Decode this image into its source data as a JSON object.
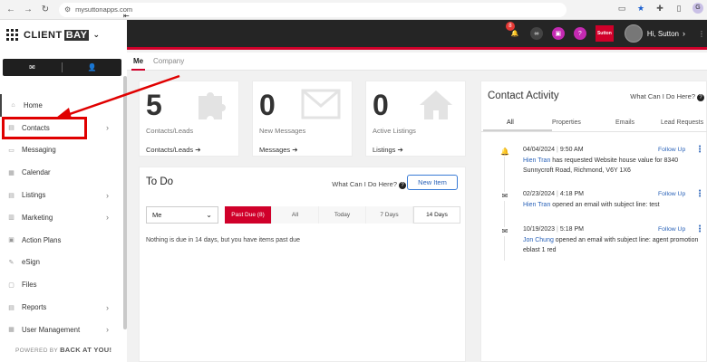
{
  "browser": {
    "url": "mysuttonapps.com",
    "profile_initial": "G"
  },
  "sidebar": {
    "brand_main": "CLIENT",
    "brand_accent": "BAY",
    "items": [
      {
        "label": "Home",
        "icon": "home-icon",
        "has_arrow": false
      },
      {
        "label": "Contacts",
        "icon": "contacts-icon",
        "has_arrow": true
      },
      {
        "label": "Messaging",
        "icon": "chat-icon",
        "has_arrow": false
      },
      {
        "label": "Calendar",
        "icon": "calendar-icon",
        "has_arrow": false
      },
      {
        "label": "Listings",
        "icon": "listings-icon",
        "has_arrow": true
      },
      {
        "label": "Marketing",
        "icon": "marketing-icon",
        "has_arrow": true
      },
      {
        "label": "Action Plans",
        "icon": "action-plans-icon",
        "has_arrow": false
      },
      {
        "label": "eSign",
        "icon": "esign-icon",
        "has_arrow": false
      },
      {
        "label": "Files",
        "icon": "files-icon",
        "has_arrow": false
      },
      {
        "label": "Reports",
        "icon": "reports-icon",
        "has_arrow": true
      },
      {
        "label": "User Management",
        "icon": "user-management-icon",
        "has_arrow": true
      }
    ],
    "powered_prefix": "POWERED BY",
    "powered_brand": "BACK AT YOU!"
  },
  "topbar": {
    "notification_count": "8",
    "greeting": "Hi, Sutton",
    "logo_text": "Sutton"
  },
  "tabs": {
    "me": "Me",
    "company": "Company"
  },
  "stats": [
    {
      "value": "5",
      "label": "Contacts/Leads",
      "link": "Contacts/Leads",
      "icon": "puzzle-icon"
    },
    {
      "value": "0",
      "label": "New Messages",
      "link": "Messages",
      "icon": "envelope-icon"
    },
    {
      "value": "0",
      "label": "Active Listings",
      "link": "Listings",
      "icon": "house-icon"
    }
  ],
  "todo": {
    "title": "To Do",
    "help": "What Can I Do Here?",
    "new_item": "New Item",
    "select_value": "Me",
    "filters": [
      "Past Due (8)",
      "All",
      "Today",
      "7 Days",
      "14 Days"
    ],
    "message": "Nothing is due in 14 days, but you have items past due"
  },
  "activity": {
    "title": "Contact Activity",
    "help": "What Can I Do Here?",
    "tabs": [
      "All",
      "Properties",
      "Emails",
      "Lead Requests"
    ],
    "follow_label": "Follow Up",
    "items": [
      {
        "type": "bell-icon",
        "date": "04/04/2024",
        "time": "9:50 AM",
        "name": "Hien Tran",
        "text": " has requested Website house value for 8340 Sunnycroft Road, Richmond, V6Y 1X6"
      },
      {
        "type": "email-icon",
        "date": "02/23/2024",
        "time": "4:18 PM",
        "name": "Hien Tran",
        "text": " opened an email with subject line: test"
      },
      {
        "type": "email-icon",
        "date": "10/19/2023",
        "time": "5:18 PM",
        "name": "Jon Chung",
        "text": " opened an email with subject line: agent promotion eblast 1 red"
      }
    ]
  },
  "colors": {
    "accent_red": "#d0002a",
    "link_blue": "#2a62b8",
    "topbar_bg": "#252525",
    "annotation_red": "#e00000"
  }
}
